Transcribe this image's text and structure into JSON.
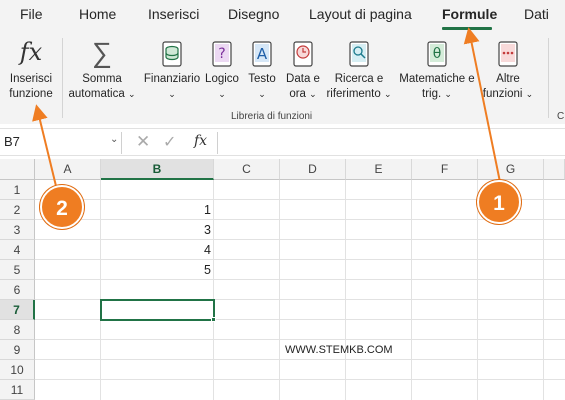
{
  "tabs": [
    {
      "label": "File",
      "active": false
    },
    {
      "label": "Home",
      "active": false
    },
    {
      "label": "Inserisci",
      "active": false
    },
    {
      "label": "Disegno",
      "active": false
    },
    {
      "label": "Layout di pagina",
      "active": false
    },
    {
      "label": "Formule",
      "active": true
    },
    {
      "label": "Dati",
      "active": false
    }
  ],
  "ribbon": {
    "insert_function": {
      "line1": "Inserisci",
      "line2": "funzione",
      "icon": "fx-icon"
    },
    "autosum": {
      "line1": "Somma",
      "line2": "automatica",
      "icon": "sigma-icon"
    },
    "financial": {
      "line1": "Finanziario",
      "icon": "financial-icon"
    },
    "logical": {
      "line1": "Logico",
      "icon": "logical-icon"
    },
    "text": {
      "line1": "Testo",
      "icon": "text-icon"
    },
    "datetime": {
      "line1": "Data e",
      "line2": "ora",
      "icon": "clock-icon"
    },
    "lookup": {
      "line1": "Ricerca e",
      "line2": "riferimento",
      "icon": "lookup-icon"
    },
    "math": {
      "line1": "Matematiche e",
      "line2": "trig.",
      "icon": "theta-icon"
    },
    "more": {
      "line1": "Altre",
      "line2": "funzioni",
      "icon": "more-functions-icon"
    },
    "group_label": "Libreria di funzioni",
    "next_group_label": "C"
  },
  "formula_bar": {
    "name_box": "B7",
    "fx_label": "fx",
    "formula": ""
  },
  "columns": [
    "A",
    "B",
    "C",
    "D",
    "E",
    "F",
    "G"
  ],
  "selected_column": "B",
  "rows": [
    "1",
    "2",
    "3",
    "4",
    "5",
    "6",
    "7",
    "8",
    "9",
    "10",
    "11"
  ],
  "selected_row": "7",
  "cells": {
    "B2": "1",
    "B3": "3",
    "B4": "4",
    "B5": "5",
    "D9": "WWW.STEMKB.COM"
  },
  "callouts": [
    {
      "label": "1",
      "target": "Formule"
    },
    {
      "label": "2",
      "target": "Inserisci funzione"
    }
  ],
  "colors": {
    "accent_green": "#217346",
    "callout_orange": "#ef7d22"
  }
}
